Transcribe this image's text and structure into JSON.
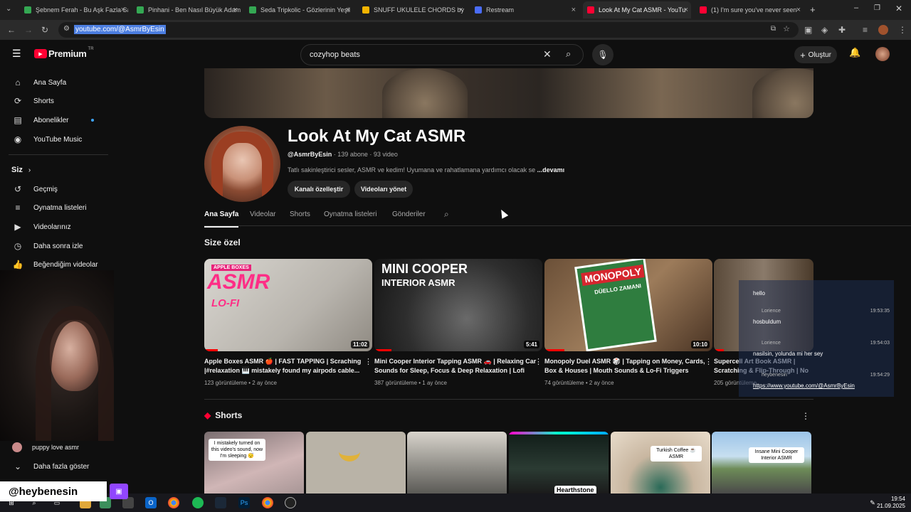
{
  "browser": {
    "tabs": [
      {
        "label": "Şebnem Ferah - Bu Aşk Fazla Sa",
        "color": "#34a853"
      },
      {
        "label": "Pinhani - Ben Nasıl Büyük Adam",
        "color": "#34a853"
      },
      {
        "label": "Seda Tripkolic - Gözlerinin Yeşil",
        "color": "#34a853"
      },
      {
        "label": "SNUFF UKULELE CHORDS by Sl",
        "color": "#f4b400"
      },
      {
        "label": "Restream",
        "color": "#4a6cf7"
      },
      {
        "label": "Look At My Cat ASMR - YouTu",
        "color": "#ff0033"
      },
      {
        "label": "(1) I'm sure you've never seen",
        "color": "#ff0033"
      }
    ],
    "url": "youtube.com/@AsmrByEsin"
  },
  "youtube": {
    "logo_label": "Premium",
    "logo_region": "TR",
    "search_value": "cozyhop beats",
    "create_label": "Oluştur"
  },
  "sidebar": {
    "main": [
      {
        "label": "Ana Sayfa",
        "icon": "home-icon"
      },
      {
        "label": "Shorts",
        "icon": "shorts-icon"
      },
      {
        "label": "Abonelikler",
        "icon": "subscriptions-icon"
      },
      {
        "label": "YouTube Music",
        "icon": "music-icon"
      }
    ],
    "you_label": "Siz",
    "you": [
      {
        "label": "Geçmiş",
        "icon": "history-icon"
      },
      {
        "label": "Oynatma listeleri",
        "icon": "playlists-icon"
      },
      {
        "label": "Videolarınız",
        "icon": "your-videos-icon"
      },
      {
        "label": "Daha sonra izle",
        "icon": "watch-later-icon"
      },
      {
        "label": "Beğendiğim videolar",
        "icon": "liked-icon"
      }
    ],
    "sub_item": "puppy love asmr",
    "show_more": "Daha fazla göster"
  },
  "channel": {
    "name": "Look At My Cat ASMR",
    "handle": "@AsmrByEsin",
    "subs": "139 abone",
    "videos": "93 video",
    "description": "Tatlı sakinleştirici sesler, ASMR ve kedim! Uyumana ve rahatlamana yardımcı olacak se",
    "more": "...devamı",
    "customize_label": "Kanalı özelleştir",
    "manage_label": "Videoları yönet"
  },
  "tabs": [
    "Ana Sayfa",
    "Videolar",
    "Shorts",
    "Oynatma listeleri",
    "Gönderiler"
  ],
  "section_title": "Size özel",
  "videos": [
    {
      "title": "Apple Boxes ASMR 🍎 | FAST TAPPING | Scraching |#relaxation 🎹 mistakely found my airpods cable...",
      "meta": "123 görüntüleme • 2 ay önce",
      "duration": "11:02",
      "progress": 0.08
    },
    {
      "title": "Mini Cooper Interior Tapping ASMR 🚗 | Relaxing Car Sounds for Sleep, Focus & Deep Relaxation | Lofi",
      "meta": "387 görüntüleme • 1 ay önce",
      "duration": "5:41",
      "progress": 0.1
    },
    {
      "title": "Monopoly Duel ASMR 🎲 | Tapping on Money, Cards, Box & Houses | Mouth Sounds & Lo-Fi Triggers",
      "meta": "74 görüntüleme • 2 ay önce",
      "duration": "10:10",
      "progress": 0.12
    },
    {
      "title": "Supercell Art Book ASMR | Scratching & Flip-Through | No Ta",
      "meta": "205 görüntüleme",
      "duration": "",
      "progress": 0.1
    }
  ],
  "thumb_text": {
    "v1_top": "APPLE BOXES",
    "v1_main": "ASMR",
    "v1_sub": "LO-FI",
    "v2_line1": "MINI COOPER",
    "v2_line2": "INTERIOR ASMR",
    "v3_main": "MONOPOLY",
    "v3_sub": "DÜELLO ZAMANI"
  },
  "shorts_title": "Shorts",
  "shorts_captions": [
    "I mistakely turned on this video's sound, now I'm sleeping 😴",
    "",
    "",
    "Hearthstone",
    "Turkish Coffee ☕ ASMR",
    "Insane Mini Cooper Interior ASMR"
  ],
  "chat": [
    {
      "user": "",
      "time": "",
      "msg": "hello"
    },
    {
      "user": "Lorience",
      "time": "19:53:35",
      "msg": "hosbuldum"
    },
    {
      "user": "Lorience",
      "time": "19:54:03",
      "msg": "nasilsin, yolunda mi her sey"
    },
    {
      "user": "heybenesin",
      "time": "19:54:29",
      "msg": "https://www.youtube.com/@AsmrByEsin"
    }
  ],
  "stream_tag": "@heybenesin",
  "clock": {
    "time": "19:54",
    "date": "21.09.2025"
  },
  "colors": {
    "brand": "#ff0033",
    "background": "#0f0f0f",
    "chip": "#272727",
    "twitch": "#9146ff"
  }
}
